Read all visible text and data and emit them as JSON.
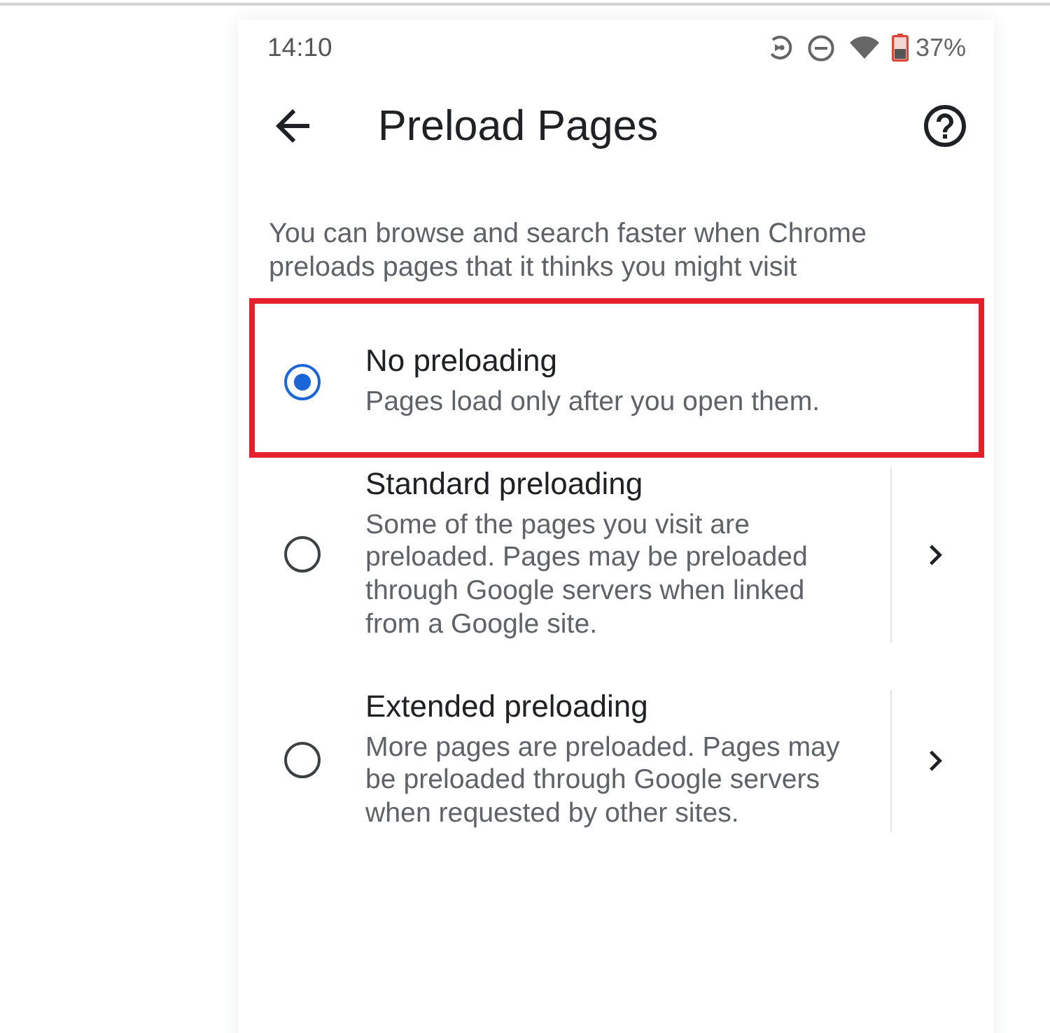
{
  "status_bar": {
    "time": "14:10",
    "battery": "37%"
  },
  "header": {
    "title": "Preload Pages"
  },
  "description": "You can browse and search faster when Chrome\npreloads pages that it thinks you might visit",
  "options": [
    {
      "kind": "plain",
      "title": "No preloading",
      "summary": "Pages load only after you open them.",
      "selected": true,
      "highlighted": true
    },
    {
      "kind": "expandable",
      "title": "Standard preloading",
      "summary": "Some of the pages you visit are\npreloaded. Pages may be preloaded\nthrough Google servers when linked\nfrom a Google site.",
      "selected": false,
      "highlighted": false
    },
    {
      "kind": "expandable",
      "title": "Extended preloading",
      "summary": "More pages are preloaded. Pages may\nbe preloaded through Google servers\nwhen requested by other sites.",
      "selected": false,
      "highlighted": false
    }
  ]
}
